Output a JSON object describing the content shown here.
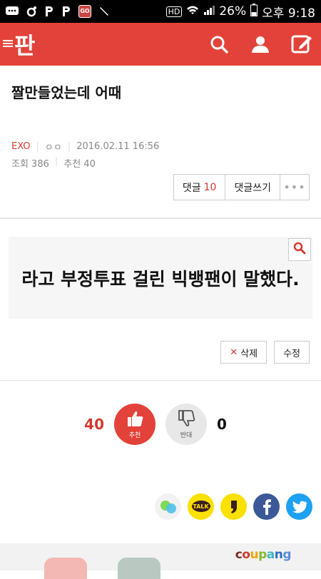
{
  "statusbar": {
    "battery": "26%",
    "time": "오후 9:18",
    "hd": "HD"
  },
  "header": {
    "logo": "판",
    "icons": [
      "search-icon",
      "user-icon",
      "write-icon"
    ]
  },
  "post": {
    "title": "짤만들었는데 어때",
    "author": "EXO",
    "nickname": "ㅇㅇ",
    "datetime": "2016.02.11 16:56",
    "views_label": "조회 386",
    "recommend_label": "추천 40"
  },
  "comments": {
    "label": "댓글",
    "count": "10",
    "write": "댓글쓰기",
    "more": "•••"
  },
  "content": {
    "image_text": "라고 부정투표 걸린 빅뱅팬이 말했다."
  },
  "actions": {
    "delete_mark": "✕",
    "delete": "삭제",
    "edit": "수정"
  },
  "votes": {
    "up_count": "40",
    "up_label": "추천",
    "down_label": "반대",
    "down_count": "0"
  },
  "share": {
    "talk": "TALK"
  },
  "ad": {
    "brand_c": "c",
    "brand_o": "o",
    "brand_u": "u",
    "brand_p": "p",
    "brand_a": "a",
    "brand_n": "n",
    "brand_g": "g"
  },
  "colors": {
    "accent": "#e3423a",
    "kakao": "#fae100",
    "facebook": "#3b5998",
    "twitter": "#1da1f2"
  }
}
